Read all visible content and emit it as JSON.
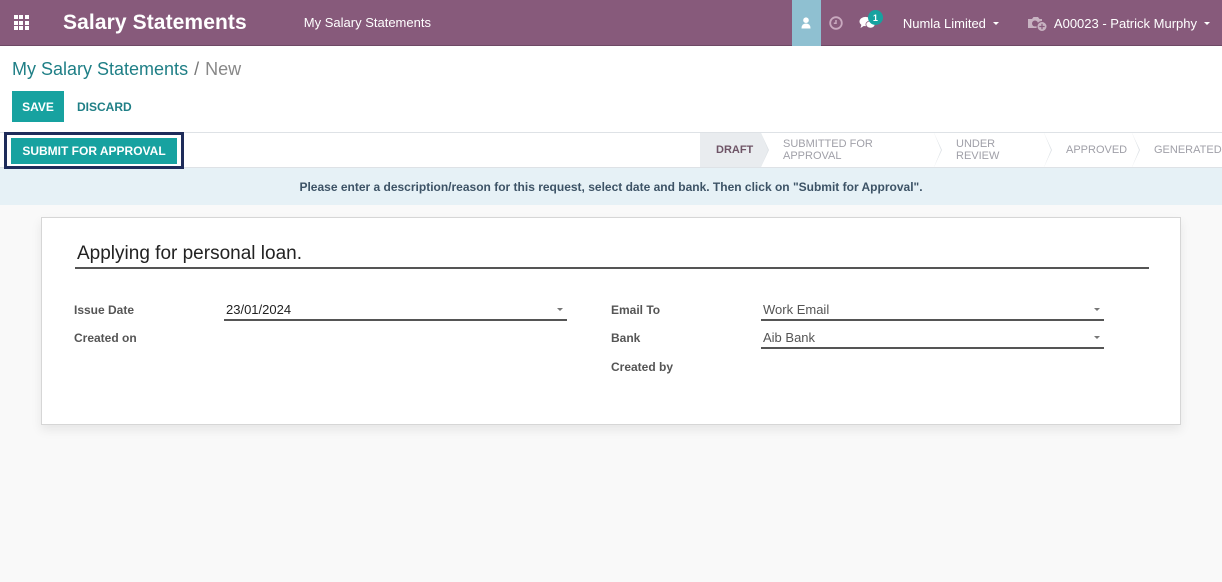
{
  "navbar": {
    "app_title": "Salary Statements",
    "menu_link": "My Salary Statements",
    "messages_badge": "1",
    "company": "Numla Limited",
    "employee": "A00023 - Patrick Murphy",
    "icons": {
      "apps": "grid-icon",
      "user": "user-icon",
      "activity": "clock-icon",
      "messages": "chat-icon",
      "camera": "camera-plus-icon"
    }
  },
  "breadcrumb": {
    "parent": "My Salary Statements",
    "separator": "/",
    "current": "New"
  },
  "toolbar": {
    "save_label": "SAVE",
    "discard_label": "DISCARD"
  },
  "statusbar": {
    "submit_label": "SUBMIT FOR APPROVAL",
    "stages": [
      {
        "label": "DRAFT",
        "active": true
      },
      {
        "label": "SUBMITTED FOR APPROVAL",
        "active": false
      },
      {
        "label": "UNDER REVIEW",
        "active": false
      },
      {
        "label": "APPROVED",
        "active": false
      },
      {
        "label": "GENERATED",
        "active": false
      }
    ]
  },
  "alert": {
    "message": "Please enter a description/reason for this request, select date and bank. Then click on \"Submit for Approval\"."
  },
  "form": {
    "description": "Applying for personal loan.",
    "left": {
      "issue_date_label": "Issue Date",
      "issue_date_value": "23/01/2024",
      "created_on_label": "Created on",
      "created_on_value": ""
    },
    "right": {
      "email_to_label": "Email To",
      "email_to_value": "Work Email",
      "bank_label": "Bank",
      "bank_value": "Aib Bank",
      "created_by_label": "Created by",
      "created_by_value": ""
    }
  },
  "colors": {
    "navbar": "#875a7b",
    "primary": "#17a2a0",
    "link": "#1f7f86",
    "alert_bg": "#e6f1f6",
    "focus_outline": "#1e2c5a"
  }
}
